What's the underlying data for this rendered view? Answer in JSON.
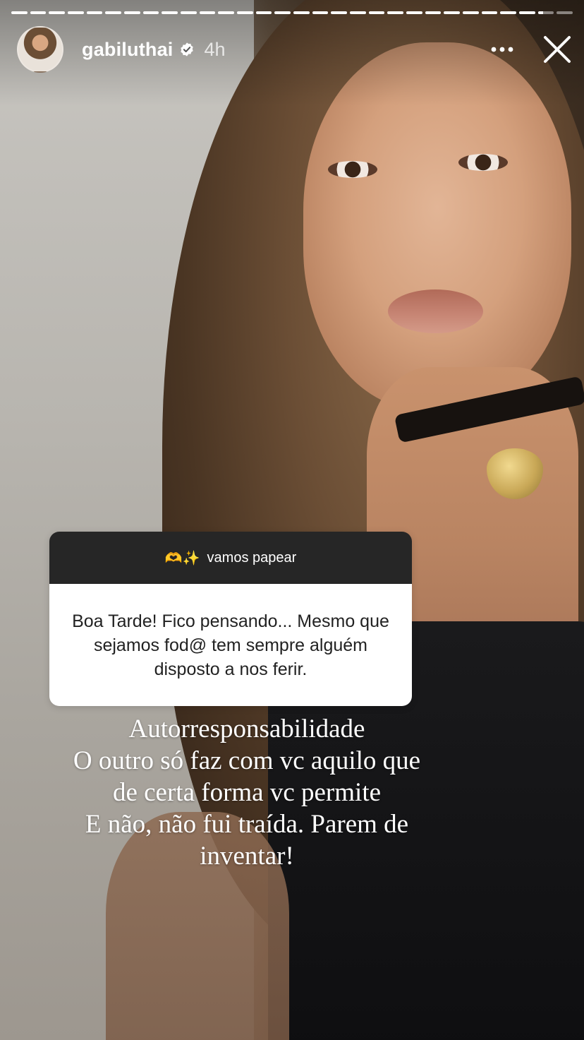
{
  "story": {
    "progress_segments": [
      1,
      1,
      1,
      1,
      1,
      1,
      1,
      1,
      1,
      1,
      1,
      1,
      1,
      1,
      1,
      1,
      1,
      1,
      1,
      1,
      1,
      1,
      1,
      1,
      1,
      1,
      1,
      1,
      0.3,
      0
    ],
    "username": "gabiluthai",
    "verified": true,
    "time_ago": "4h",
    "more_icon": "more-horizontal-icon",
    "close_icon": "close-icon"
  },
  "question_sticker": {
    "prompt_emoji": "🫶✨",
    "prompt": "vamos papear",
    "answer": "Boa Tarde! Fico pensando... Mesmo que sejamos fod@ tem sempre alguém disposto a nos ferir."
  },
  "caption": {
    "lines": [
      "Autorresponsabilidade",
      "O outro só faz com vc aquilo que",
      "de certa forma vc permite",
      "E não, não fui traída. Parem de",
      "inventar!"
    ]
  },
  "colors": {
    "sticker_header": "#262626",
    "sticker_body": "#ffffff",
    "verified_badge": "#ffffff"
  }
}
